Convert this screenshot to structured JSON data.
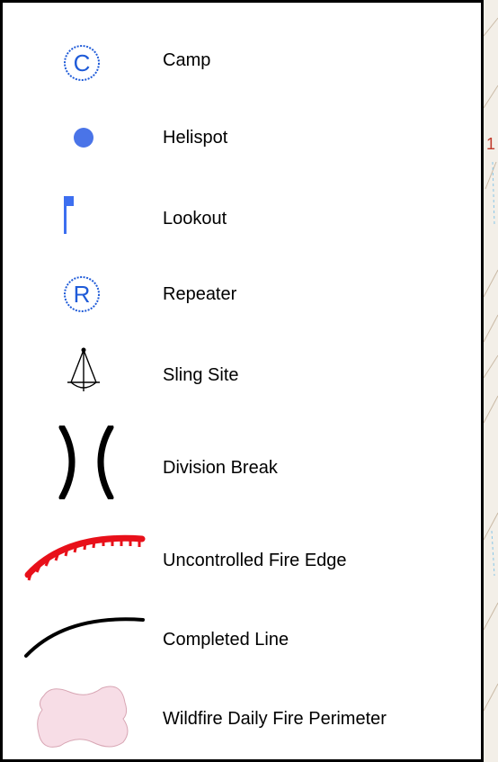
{
  "legend": {
    "items": [
      {
        "id": "camp",
        "label": "Camp",
        "symbol": "circled-c-icon",
        "color": "#1f5bd8"
      },
      {
        "id": "helispot",
        "label": "Helispot",
        "symbol": "filled-dot-icon",
        "color": "#4a74e8"
      },
      {
        "id": "lookout",
        "label": "Lookout",
        "symbol": "flag-icon",
        "color": "#3d6ff0"
      },
      {
        "id": "repeater",
        "label": "Repeater",
        "symbol": "circled-r-icon",
        "color": "#1f5bd8"
      },
      {
        "id": "sling-site",
        "label": "Sling Site",
        "symbol": "sling-site-icon",
        "color": "#000000"
      },
      {
        "id": "division-break",
        "label": "Division Break",
        "symbol": "division-break-icon",
        "color": "#000000"
      },
      {
        "id": "uncontrolled-fire-edge",
        "label": "Uncontrolled Fire Edge",
        "symbol": "hatched-arc-icon",
        "color": "#e8101a"
      },
      {
        "id": "completed-line",
        "label": "Completed Line",
        "symbol": "arc-line-icon",
        "color": "#000000"
      },
      {
        "id": "wildfire-daily-fire-perimeter",
        "label": "Wildfire Daily Fire Perimeter",
        "symbol": "perimeter-blob-icon",
        "color": "#f7dde6"
      }
    ]
  },
  "map_edge_marker": "1"
}
